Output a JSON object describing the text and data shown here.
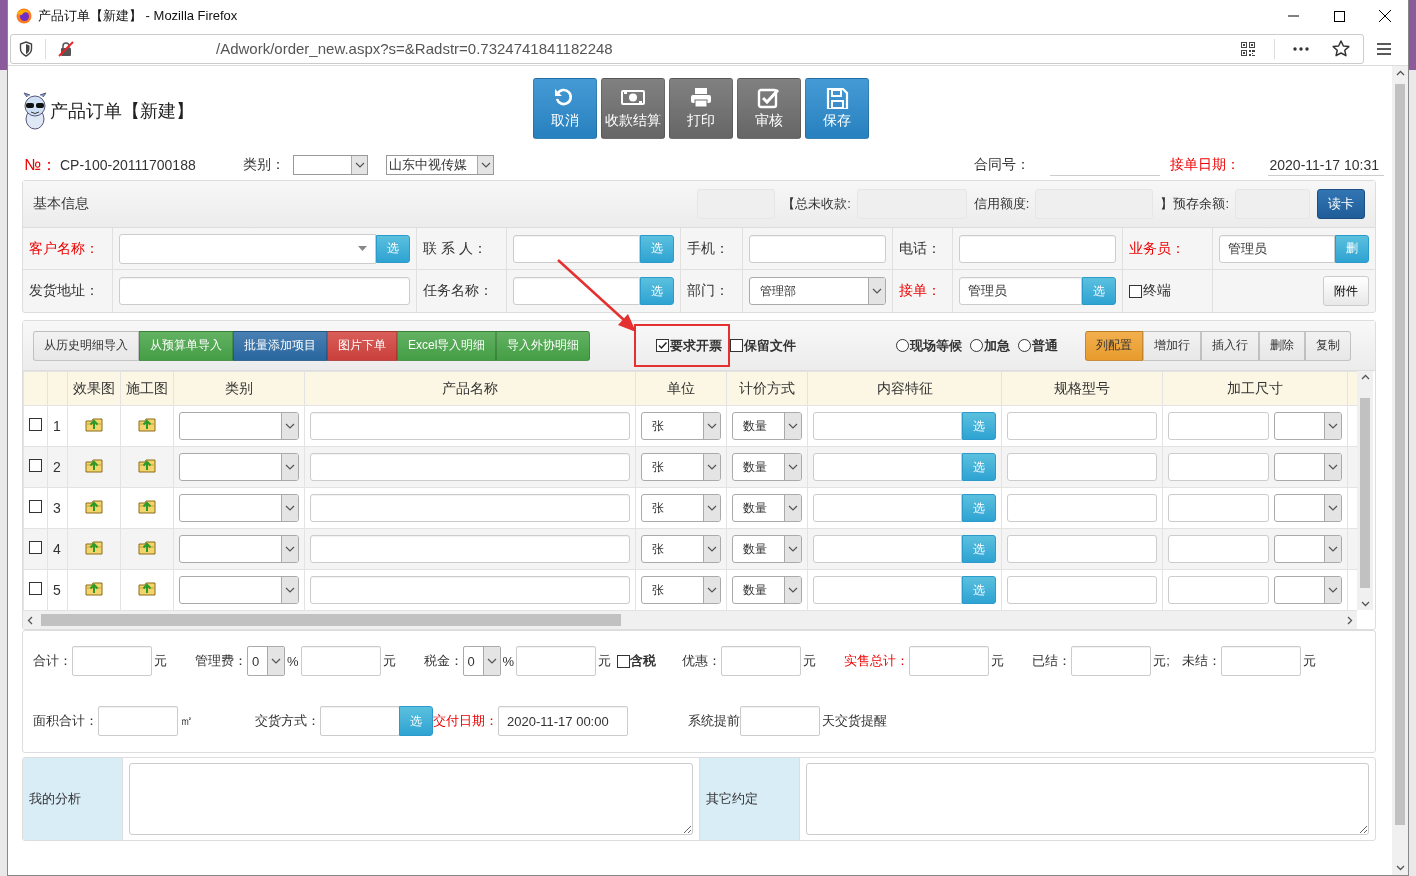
{
  "browser": {
    "title": "产品订单【新建】 - Mozilla Firefox",
    "url": "/Adwork/order_new.aspx?s=&Radstr=0.7324741841182248"
  },
  "header": {
    "title": "产品订单【新建】",
    "buttons": [
      {
        "label": "取消",
        "kind": "undo",
        "color": "#2b8ccf"
      },
      {
        "label": "收款结算",
        "kind": "money",
        "color": "#6f6f6f"
      },
      {
        "label": "打印",
        "kind": "print",
        "color": "#6f6f6f"
      },
      {
        "label": "审核",
        "kind": "approve",
        "color": "#6f6f6f"
      },
      {
        "label": "保存",
        "kind": "save",
        "color": "#2b8ccf"
      }
    ]
  },
  "info": {
    "number_label": "№：",
    "number": "CP-100-20111700188",
    "category_label": "类别：",
    "company": "山东中视传媒",
    "contract_label": "合同号：",
    "date_label": "接单日期：",
    "date": "2020-11-17 10:31"
  },
  "basic": {
    "title": "基本信息",
    "summary": [
      {
        "label": "【总未收款:"
      },
      {
        "label": "信用额度:"
      },
      {
        "label": "】预存余额:"
      }
    ],
    "read_card": "读卡",
    "rows": [
      [
        {
          "kind": "label",
          "text": "客户名称：",
          "required": true
        },
        {
          "kind": "combo",
          "button": "选"
        },
        {
          "kind": "label",
          "text": "联 系 人：",
          "required": false
        },
        {
          "kind": "input",
          "button": "选"
        },
        {
          "kind": "label",
          "text": "手机：",
          "required": false
        },
        {
          "kind": "input"
        },
        {
          "kind": "label",
          "text": "电话：",
          "required": false
        },
        {
          "kind": "input"
        },
        {
          "kind": "label",
          "text": "业务员：",
          "required": true
        },
        {
          "kind": "input",
          "value": "管理员",
          "button": "删"
        }
      ],
      [
        {
          "kind": "label",
          "text": "发货地址：",
          "required": false
        },
        {
          "kind": "input"
        },
        {
          "kind": "label",
          "text": "任务名称：",
          "required": false
        },
        {
          "kind": "input",
          "button": "选"
        },
        {
          "kind": "label",
          "text": "部门：",
          "required": false
        },
        {
          "kind": "select",
          "value": "管理部"
        },
        {
          "kind": "label",
          "text": "接单：",
          "required": true
        },
        {
          "kind": "input",
          "value": "管理员",
          "button": "选"
        },
        {
          "kind": "check",
          "label": "终端",
          "checked": false
        },
        {
          "kind": "button",
          "label": "附件"
        }
      ]
    ]
  },
  "toolbar": {
    "import_buttons": [
      {
        "label": "从历史明细导入",
        "color": "#f0f0f0"
      },
      {
        "label": "从预算单导入",
        "color": "#47a447"
      },
      {
        "label": "批量添加项目",
        "color": "#2a6aa5"
      },
      {
        "label": "图片下单",
        "color": "#d2423d"
      },
      {
        "label": "Excel导入明细",
        "color": "#47a447"
      },
      {
        "label": "导入外协明细",
        "color": "#47a447"
      }
    ],
    "options": [
      {
        "kind": "checkbox",
        "label": "要求开票",
        "checked": true,
        "highlighted": true
      },
      {
        "kind": "checkbox",
        "label": "保留文件",
        "checked": false,
        "highlighted": false
      },
      {
        "kind": "radio",
        "label": "现场等候",
        "selected": false
      },
      {
        "kind": "radio",
        "label": "加急",
        "selected": false
      },
      {
        "kind": "radio",
        "label": "普通",
        "selected": false
      }
    ],
    "row_buttons": [
      {
        "label": "列配置",
        "color": "#f0a12e"
      },
      {
        "label": "增加行",
        "color": "#f0f0f0"
      },
      {
        "label": "插入行",
        "color": "#f0f0f0"
      },
      {
        "label": "删除",
        "color": "#f0f0f0"
      },
      {
        "label": "复制",
        "color": "#f0f0f0"
      }
    ]
  },
  "table": {
    "columns": [
      {
        "label": "效果图",
        "kind": "image"
      },
      {
        "label": "施工图",
        "kind": "image"
      },
      {
        "label": "类别",
        "kind": "select"
      },
      {
        "label": "产品名称",
        "kind": "input"
      },
      {
        "label": "单位",
        "kind": "unit"
      },
      {
        "label": "计价方式",
        "kind": "pricing"
      },
      {
        "label": "内容特征",
        "kind": "pick"
      },
      {
        "label": "规格型号",
        "kind": "textarea"
      },
      {
        "label": "加工尺寸",
        "kind": "size"
      }
    ],
    "rows": [
      {
        "no": "1",
        "checked": false,
        "unit": "张",
        "pricing": "数量",
        "pick_button": "选"
      },
      {
        "no": "2",
        "checked": false,
        "unit": "张",
        "pricing": "数量",
        "pick_button": "选"
      },
      {
        "no": "3",
        "checked": false,
        "unit": "张",
        "pricing": "数量",
        "pick_button": "选"
      },
      {
        "no": "4",
        "checked": false,
        "unit": "张",
        "pricing": "数量",
        "pick_button": "选"
      },
      {
        "no": "5",
        "checked": false,
        "unit": "张",
        "pricing": "数量",
        "pick_button": "选"
      }
    ]
  },
  "totals": {
    "lines": [
      {
        "groups": [
          {
            "items": [
              {
                "kind": "label",
                "text": "合计：",
                "required": false
              },
              {
                "kind": "input"
              },
              {
                "kind": "unit",
                "text": "元"
              }
            ]
          },
          {
            "items": [
              {
                "kind": "label",
                "text": "管理费：",
                "required": false
              },
              {
                "kind": "select",
                "value": "0"
              },
              {
                "kind": "unit",
                "text": "%"
              },
              {
                "kind": "input"
              },
              {
                "kind": "unit",
                "text": "元"
              }
            ]
          },
          {
            "items": [
              {
                "kind": "label",
                "text": "税金：",
                "required": false
              },
              {
                "kind": "select",
                "value": "0"
              },
              {
                "kind": "unit",
                "text": "%"
              },
              {
                "kind": "input"
              },
              {
                "kind": "unit",
                "text": "元"
              },
              {
                "kind": "check",
                "label": "含税",
                "checked": false
              }
            ]
          },
          {
            "items": [
              {
                "kind": "label",
                "text": "优惠：",
                "required": false
              },
              {
                "kind": "input"
              },
              {
                "kind": "unit",
                "text": "元"
              }
            ]
          },
          {
            "items": [
              {
                "kind": "label",
                "text": "实售总计：",
                "required": true
              },
              {
                "kind": "input"
              },
              {
                "kind": "unit",
                "text": "元"
              }
            ]
          },
          {
            "items": [
              {
                "kind": "label",
                "text": "已结：",
                "required": false
              },
              {
                "kind": "input"
              },
              {
                "kind": "unit",
                "text": "元;"
              },
              {
                "kind": "label",
                "text": "未结：",
                "required": false
              },
              {
                "kind": "input"
              },
              {
                "kind": "unit",
                "text": "元"
              }
            ]
          }
        ]
      },
      {
        "groups": [
          {
            "items": [
              {
                "kind": "label",
                "text": "面积合计：",
                "required": false
              },
              {
                "kind": "input"
              },
              {
                "kind": "unit",
                "text": "㎡"
              }
            ]
          },
          {
            "items": [
              {
                "kind": "label",
                "text": "交货方式：",
                "required": false
              },
              {
                "kind": "input"
              },
              {
                "kind": "pick",
                "label": "选"
              },
              {
                "kind": "label",
                "text": "交付日期：",
                "required": true
              },
              {
                "kind": "input",
                "value": "2020-11-17 00:00"
              }
            ]
          },
          {
            "items": [
              {
                "kind": "label",
                "text": "系统提前",
                "required": false
              },
              {
                "kind": "input"
              },
              {
                "kind": "unit",
                "text": "天交货提醒"
              }
            ]
          }
        ]
      }
    ]
  },
  "notes": [
    {
      "label": "我的分析"
    },
    {
      "label": "其它约定"
    }
  ]
}
